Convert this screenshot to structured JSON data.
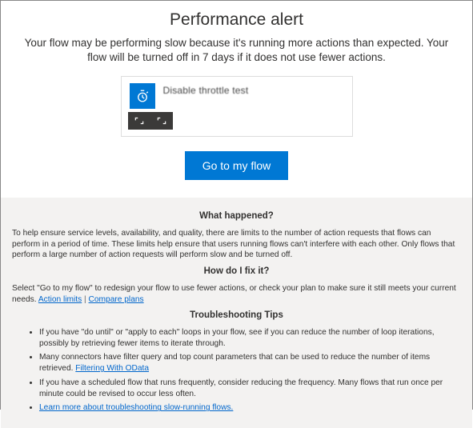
{
  "header": {
    "title": "Performance alert",
    "subtitle": "Your flow may be performing slow because it's running more actions than expected. Your flow will be turned off in 7 days if it does not use fewer actions."
  },
  "flow_card": {
    "name": "Disable throttle test"
  },
  "cta": {
    "label": "Go to my flow"
  },
  "info": {
    "what_happened_heading": "What happened?",
    "what_happened_body": "To help ensure service levels, availability, and quality, there are limits to the number of action requests that flows can perform in a period of time. These limits help ensure that users running flows can't interfere with each other. Only flows that perform a large number of action requests will perform slow and be turned off.",
    "how_fix_heading": "How do I fix it?",
    "how_fix_prefix": "Select \"Go to my flow\" to redesign your flow to use fewer actions, or check your plan to make sure it still meets your current needs. ",
    "link_action_limits": "Action limits",
    "link_compare_plans": "Compare plans",
    "tips_heading": "Troubleshooting Tips",
    "tips": [
      {
        "text": "If you have \"do until\" or \"apply to each\" loops in your flow, see if you can reduce the number of loop iterations, possibly by retrieving fewer items to iterate through."
      },
      {
        "text": "Many connectors have filter query and top count parameters that can be used to reduce the number of items retrieved. ",
        "link": "Filtering With OData"
      },
      {
        "text": "If you have a scheduled flow that runs frequently, consider reducing the frequency. Many flows that run once per minute could be revised to occur less often."
      },
      {
        "link_only": "Learn more about troubleshooting slow-running flows."
      }
    ]
  }
}
